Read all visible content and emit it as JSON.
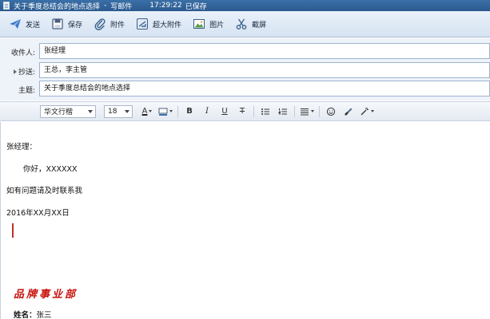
{
  "titlebar": {
    "title": "关于季度总结会的地点选择",
    "separator": "-",
    "mode": "写邮件",
    "time": "17:29:22",
    "status": "已保存"
  },
  "toolbar": {
    "send": "发送",
    "save": "保存",
    "attach": "附件",
    "large_attach": "超大附件",
    "picture": "图片",
    "screenshot": "截屏"
  },
  "fields": {
    "to_label": "收件人:",
    "to_value": "张经理",
    "cc_label": "抄送:",
    "cc_value": "王总，李主管",
    "subject_label": "主题:",
    "subject_value": "关于季度总结会的地点选择"
  },
  "format": {
    "font_family": "华文行楷",
    "font_size": "18",
    "font_color_letter": "A",
    "bold": "B",
    "italic": "I",
    "underline": "U",
    "strike": "T"
  },
  "body": {
    "greeting": "张经理：",
    "line1": "你好，XXXXXX",
    "line2": "如有问题请及时联系我",
    "date": "2016年XX月XX日",
    "signature_dept": "品牌事业部",
    "signature_name_label": "姓名：",
    "signature_name": "张三"
  },
  "colors": {
    "accent": "#2b5a8e",
    "signature": "#c8120c",
    "cursor": "#c0302a"
  }
}
